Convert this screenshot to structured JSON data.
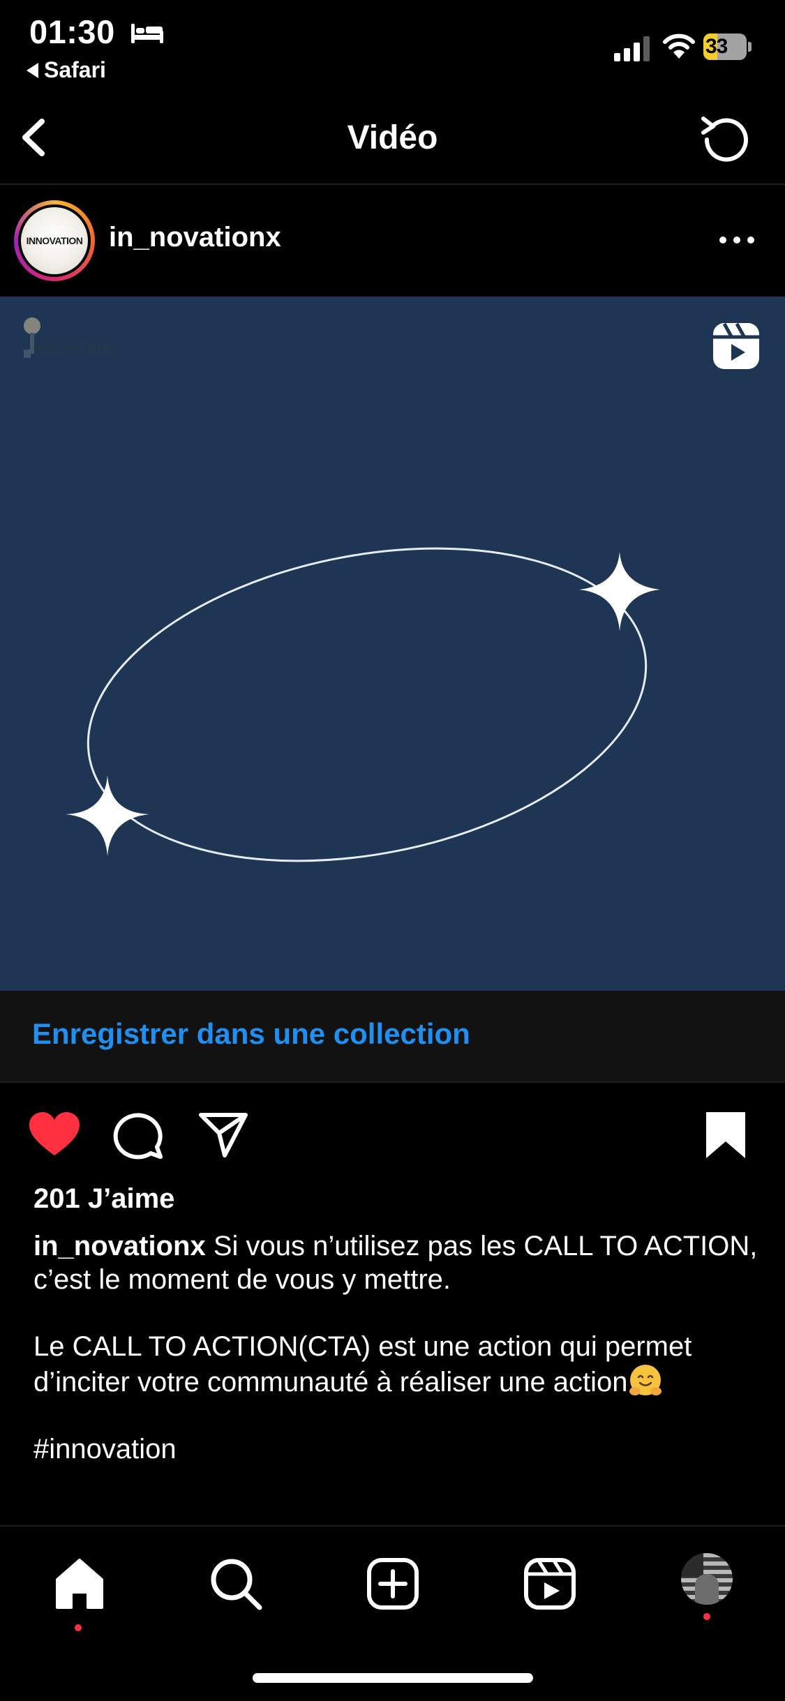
{
  "status_bar": {
    "time": "01:30",
    "back_app": "Safari",
    "battery_level": "33",
    "battery_fraction": 0.33
  },
  "nav": {
    "title": "Vidéo"
  },
  "post": {
    "username": "in_novationx",
    "avatar_text": "INNOVATION",
    "watermark_text": "INNOVATION",
    "save_to_collection": "Enregistrer dans une collection",
    "likes": "201 J’aime",
    "caption_username": "in_novationx",
    "caption_line1": "Si vous n’utilisez pas les CALL TO ACTION, c’est le moment de vous y mettre.",
    "caption_line2": "Le CALL TO ACTION(CTA) est une action qui permet d’inciter votre communauté à réaliser une action",
    "caption_hashtag": "#innovation",
    "liked": true,
    "saved": true
  },
  "colors": {
    "background": "#000000",
    "media_bg": "#1e3653",
    "link_blue": "#1f8ff0",
    "like_red": "#ff3040",
    "battery_yellow": "#f4cc2e"
  },
  "icons": [
    "bed-icon",
    "signal-icon",
    "wifi-icon",
    "battery-icon",
    "chevron-left-icon",
    "refresh-icon",
    "more-icon",
    "reels-icon",
    "heart-icon",
    "comment-icon",
    "share-icon",
    "bookmark-icon",
    "home-icon",
    "search-icon",
    "create-icon",
    "reels-tab-icon",
    "hug-emoji"
  ]
}
